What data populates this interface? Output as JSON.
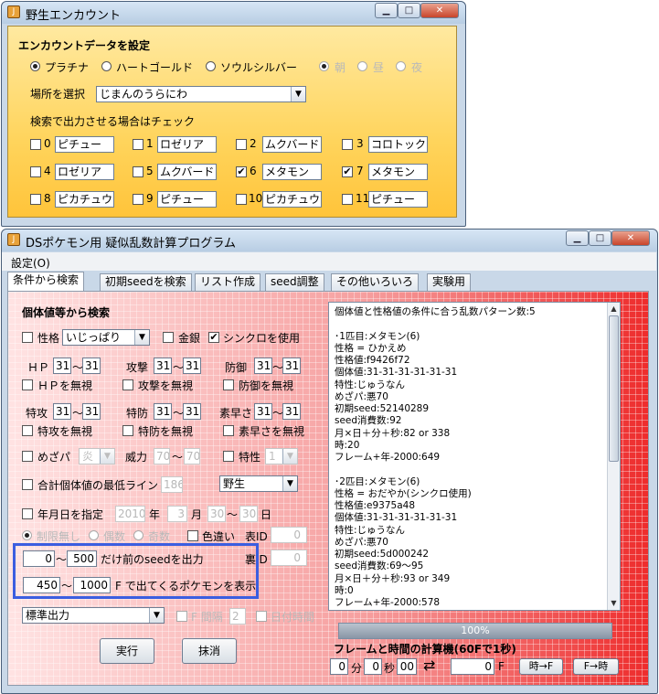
{
  "window1": {
    "title": "野生エンカウント",
    "section_title": "エンカウントデータを設定",
    "versions": [
      "プラチナ",
      "ハートゴールド",
      "ソウルシルバー"
    ],
    "selected_version": "プラチナ",
    "times": [
      "朝",
      "昼",
      "夜"
    ],
    "selected_time": "朝",
    "location_label": "場所を選択",
    "location_value": "じまんのうらにわ",
    "check_hint": "検索で出力させる場合はチェック",
    "slots": [
      {
        "index": "0",
        "name": "ピチュー",
        "checked": false
      },
      {
        "index": "1",
        "name": "ロゼリア",
        "checked": false
      },
      {
        "index": "2",
        "name": "ムクバード",
        "checked": false
      },
      {
        "index": "3",
        "name": "コロトック",
        "checked": false
      },
      {
        "index": "4",
        "name": "ロゼリア",
        "checked": false
      },
      {
        "index": "5",
        "name": "ムクバード",
        "checked": false
      },
      {
        "index": "6",
        "name": "メタモン",
        "checked": true
      },
      {
        "index": "7",
        "name": "メタモン",
        "checked": true
      },
      {
        "index": "8",
        "name": "ピカチュウ",
        "checked": false
      },
      {
        "index": "9",
        "name": "ピチュー",
        "checked": false
      },
      {
        "index": "10",
        "name": "ピカチュウ",
        "checked": false
      },
      {
        "index": "11",
        "name": "ピチュー",
        "checked": false
      }
    ]
  },
  "window2": {
    "title": "DSポケモン用 疑似乱数計算プログラム",
    "menu": "設定(O)",
    "tabs": [
      "条件から検索",
      "初期seedを検索",
      "リスト作成",
      "seed調整",
      "その他いろいろ",
      "実験用"
    ],
    "active_tab": "条件から検索",
    "iv_section": "個体値等から検索",
    "nature_label": "性格",
    "nature_value": "いじっぱり",
    "shiny_label": "金銀",
    "sync_label": "シンクロを使用",
    "stats": [
      {
        "label": "ＨＰ",
        "min": "31",
        "max": "31",
        "ignore": "ＨＰを無視"
      },
      {
        "label": "攻撃",
        "min": "31",
        "max": "31",
        "ignore": "攻撃を無視"
      },
      {
        "label": "防御",
        "min": "31",
        "max": "31",
        "ignore": "防御を無視"
      },
      {
        "label": "特攻",
        "min": "31",
        "max": "31",
        "ignore": "特攻を無視"
      },
      {
        "label": "特防",
        "min": "31",
        "max": "31",
        "ignore": "特防を無視"
      },
      {
        "label": "素早さ",
        "min": "31",
        "max": "31",
        "ignore": "素早さを無視"
      }
    ],
    "tilde": "～",
    "hp_label": "めざパ",
    "hp_type": "炎",
    "power_label": "威力",
    "power_min": "70",
    "power_max": "70",
    "ability_label": "特性",
    "ability_value": "1",
    "min_total_label": "合計個体値の最低ライン",
    "min_total_value": "186",
    "encounter_value": "野生",
    "date_label": "年月日を指定",
    "year": "2010",
    "year_unit": "年",
    "month": "3",
    "month_unit": "月",
    "day_from": "30",
    "day_to": "30",
    "day_unit": "日",
    "limit_options": [
      "制限無し",
      "偶数",
      "奇数"
    ],
    "color_label": "色違い",
    "table_id_label": "表ID",
    "table_id_value": "0",
    "back_id_label": "裏ID",
    "back_id_value": "0",
    "seed_from": "0",
    "seed_to": "500",
    "seed_suffix": "だけ前のseedを出力",
    "frame_from": "450",
    "frame_to": "1000",
    "frame_suffix": "F で出てくるポケモンを表示",
    "output_mode": "標準出力",
    "f_interval_label": "F 間隔",
    "f_interval_value": "2",
    "day_interval_label": "日付時間",
    "run_button": "実行",
    "clear_button": "抹消",
    "output_text": "個体値と性格値の条件に合う乱数パターン数:5\n\n･1匹目:メタモン(6)\n性格 = ひかえめ\n性格値:f9426f72\n個体値:31-31-31-31-31-31\n特性:じゅうなん\nめざパ:悪70\n初期seed:52140289\nseed消費数:92\n月×日＋分＋秒:82 or 338\n時:20\nフレーム+年-2000:649\n\n･2匹目:メタモン(6)\n性格 = おだやか(シンクロ使用)\n性格値:e9375a48\n個体値:31-31-31-31-31-31\n特性:じゅうなん\nめざパ:悪70\n初期seed:5d000242\nseed消費数:69～95\n月×日＋分＋秒:93 or 349\n時:0\nフレーム+年-2000:578",
    "progress": "100%",
    "progress_value": 100,
    "calc_title": "フレームと時間の計算機(60Fで1秒)",
    "calc_min": "0",
    "calc_min_unit": "分",
    "calc_sec": "0",
    "calc_sec_unit": "秒",
    "calc_frac": "00",
    "calc_frame": "0",
    "calc_frame_unit": "F",
    "time_to_f": "時→F",
    "f_to_time": "F→時"
  }
}
